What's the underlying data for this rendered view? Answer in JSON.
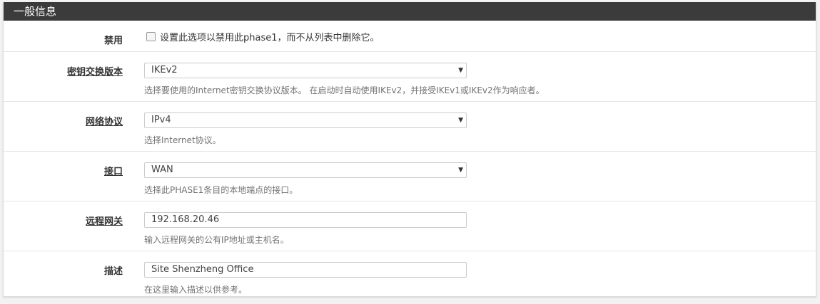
{
  "panel": {
    "title": "一般信息"
  },
  "rows": [
    {
      "label": "禁用",
      "checkbox_text": "设置此选项以禁用此phase1，而不从列表中删除它。"
    },
    {
      "label": "密钥交换版本",
      "value": "IKEv2",
      "help": "选择要使用的Internet密钥交换协议版本。 在启动时自动使用IKEv2，并接受IKEv1或IKEv2作为响应者。"
    },
    {
      "label": "网络协议",
      "value": "IPv4",
      "help": "选择Internet协议。"
    },
    {
      "label": "接口",
      "value": "WAN",
      "help": "选择此PHASE1条目的本地端点的接口。"
    },
    {
      "label": "远程网关",
      "value": "192.168.20.46",
      "help": "输入远程网关的公有IP地址或主机名。"
    },
    {
      "label": "描述",
      "value": "Site Shenzheng Office",
      "help": "在这里输入描述以供参考。"
    }
  ]
}
